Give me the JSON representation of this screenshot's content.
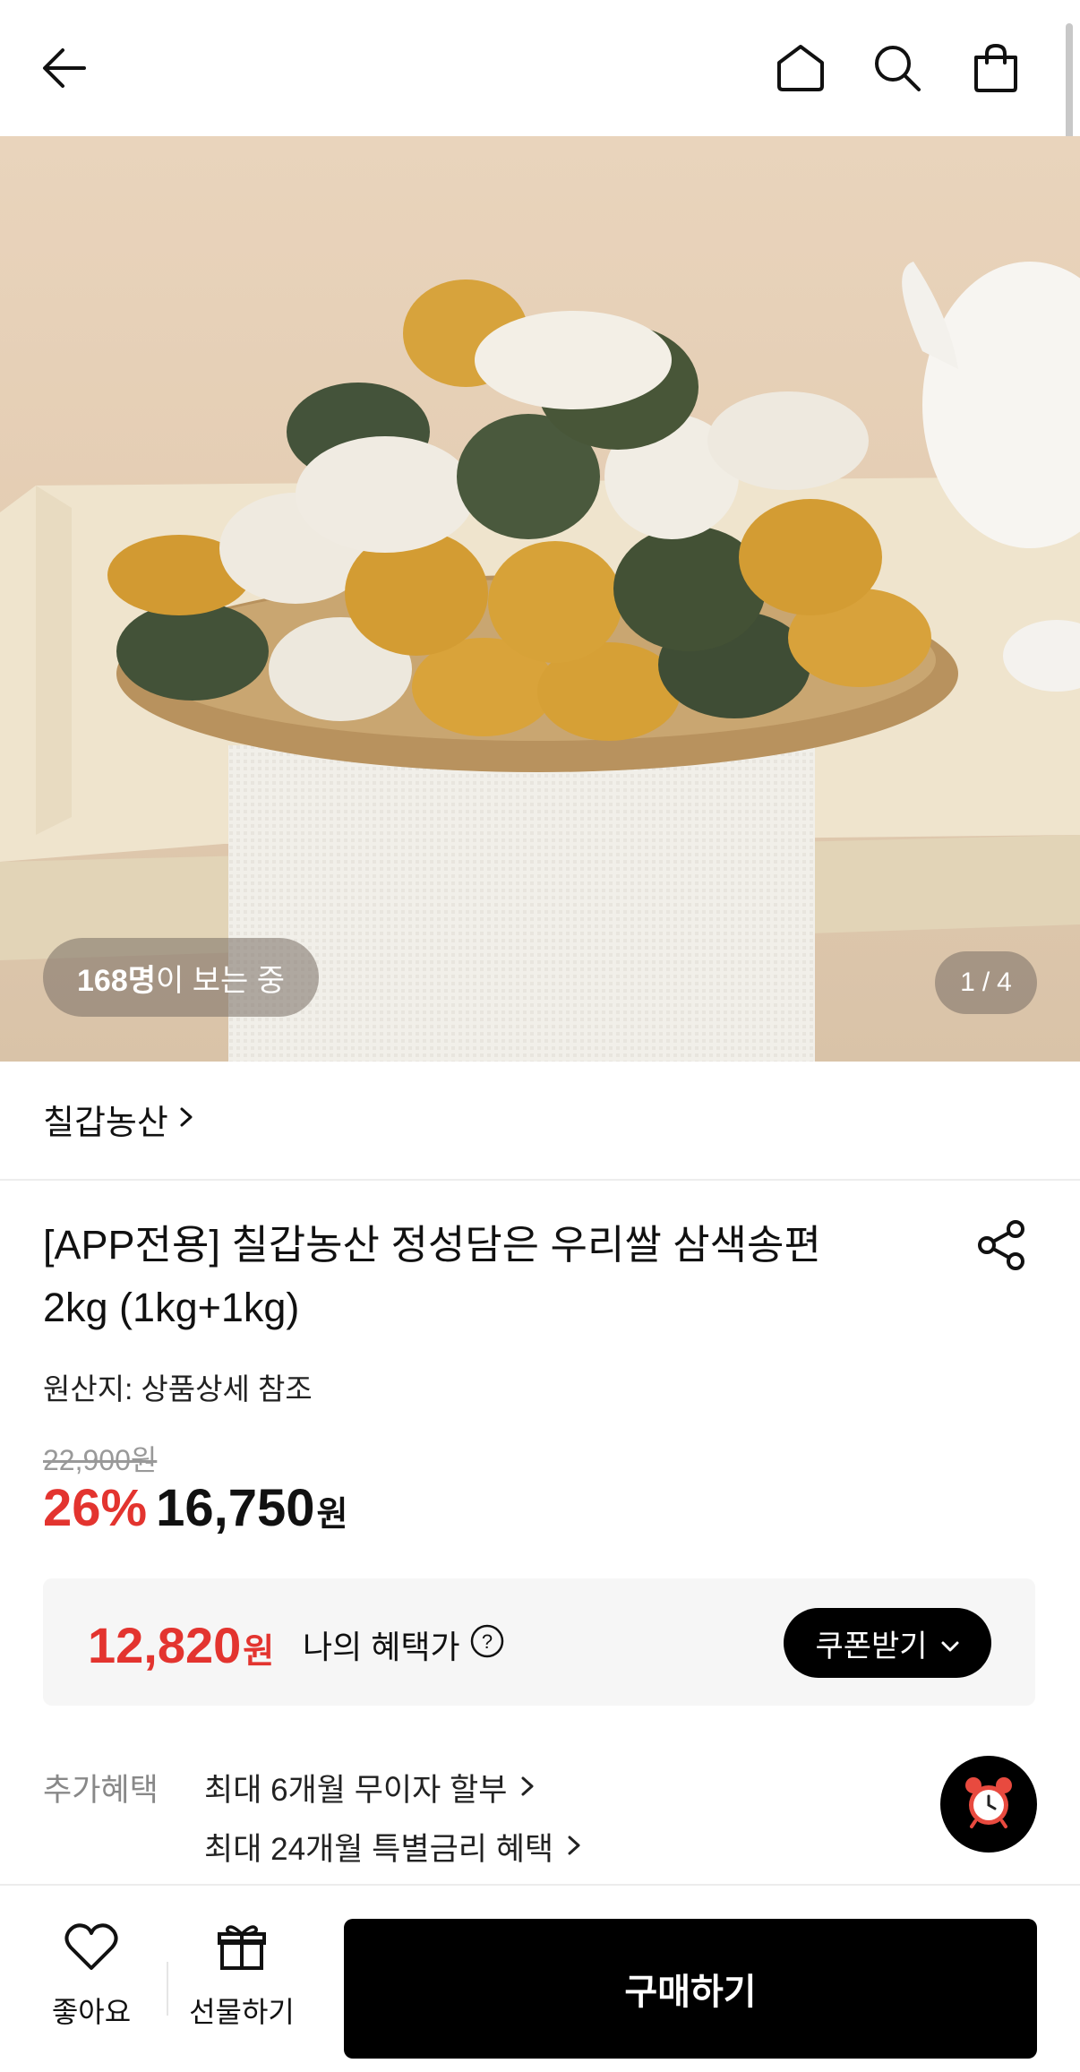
{
  "header": {
    "icons": [
      "back-arrow-icon",
      "home-icon",
      "search-icon",
      "shopping-bag-icon"
    ]
  },
  "hero": {
    "viewers_count": "168명",
    "viewers_suffix": "이 보는 중",
    "pager_current": "1",
    "pager_separator": "/",
    "pager_total": "4"
  },
  "product": {
    "brand": "칠갑농산",
    "title_line1": "[APP전용] 칠갑농산 정성담은 우리쌀 삼색송편",
    "title_line2": "2kg (1kg+1kg)",
    "origin": "원산지: 상품상세 참조",
    "original_price": "22,900원",
    "discount": "26%",
    "price": "16,750",
    "price_unit": "원"
  },
  "benefit": {
    "price": "12,820",
    "unit": "원",
    "label": "나의 혜택가",
    "coupon_button": "쿠폰받기"
  },
  "extra": {
    "label": "추가혜택",
    "items": [
      "최대 6개월 무이자 할부",
      "최대 24개월 특별금리 혜택"
    ]
  },
  "bottom": {
    "like_label": "좋아요",
    "gift_label": "선물하기",
    "buy_label": "구매하기"
  },
  "colors": {
    "accent_red": "#e3342f",
    "black": "#000000"
  }
}
